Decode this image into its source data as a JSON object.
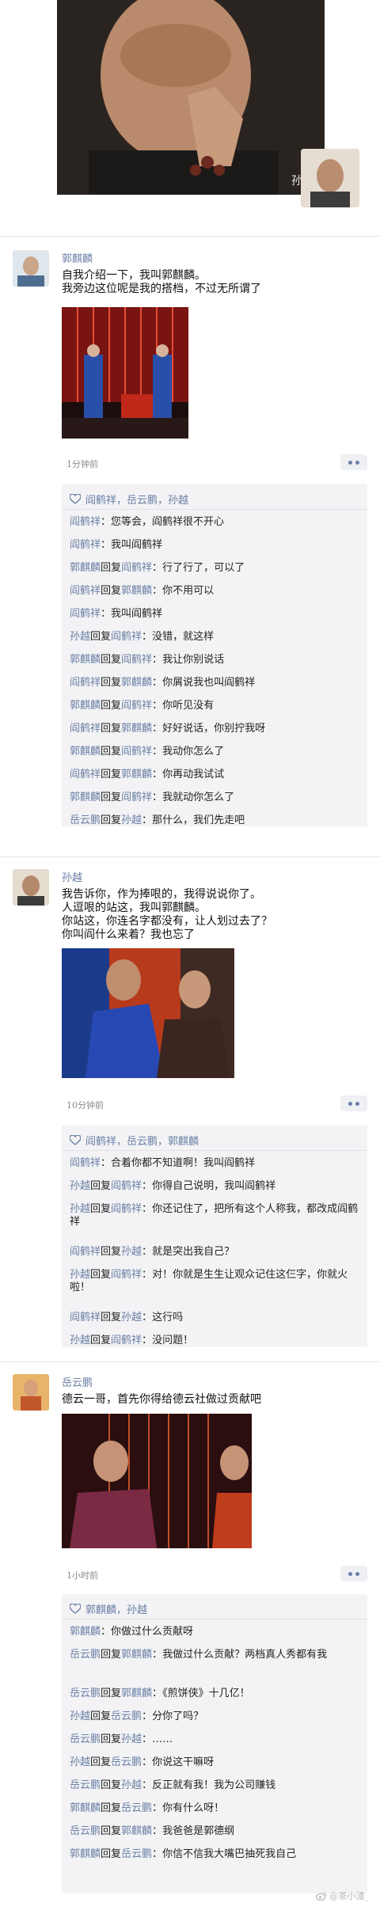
{
  "top": {
    "photo_caption": "孙越"
  },
  "posts": [
    {
      "author": "郭麒麟",
      "lines": [
        "自我介绍一下，我叫郭麒麟。",
        "我旁边这位呢是我的搭档，不过无所谓了"
      ],
      "time": "1分钟前",
      "likes": "阎鹤祥，岳云鹏，孙越",
      "comments": [
        {
          "name": "阎鹤祥",
          "reply": "",
          "to": "",
          "text": "您等会，阎鹤祥很不开心"
        },
        {
          "name": "阎鹤祥",
          "reply": "",
          "to": "",
          "text": "我叫阎鹤祥"
        },
        {
          "name": "郭麒麟",
          "reply": "回复",
          "to": "阎鹤祥",
          "text": "行了行了，可以了"
        },
        {
          "name": "阎鹤祥",
          "reply": "回复",
          "to": "郭麒麟",
          "text": "你不用可以"
        },
        {
          "name": "阎鹤祥",
          "reply": "",
          "to": "",
          "text": "我叫阎鹤祥"
        },
        {
          "name": "孙越",
          "reply": "回复",
          "to": "阎鹤祥",
          "text": "没错，就这样"
        },
        {
          "name": "郭麒麟",
          "reply": "回复",
          "to": "阎鹤祥",
          "text": "我让你别说话"
        },
        {
          "name": "阎鹤祥",
          "reply": "回复",
          "to": "郭麒麟",
          "text": "你屑说我也叫阎鹤祥"
        },
        {
          "name": "郭麒麟",
          "reply": "回复",
          "to": "阎鹤祥",
          "text": "你听见没有"
        },
        {
          "name": "阎鹤祥",
          "reply": "回复",
          "to": "郭麒麟",
          "text": "好好说话，你别拧我呀"
        },
        {
          "name": "郭麒麟",
          "reply": "回复",
          "to": "阎鹤祥",
          "text": "我动你怎么了"
        },
        {
          "name": "阎鹤祥",
          "reply": "回复",
          "to": "郭麒麟",
          "text": "你再动我试试"
        },
        {
          "name": "郭麒麟",
          "reply": "回复",
          "to": "阎鹤祥",
          "text": "我就动你怎么了"
        },
        {
          "name": "岳云鹏",
          "reply": "回复",
          "to": "孙越",
          "text": "那什么，我们先走吧"
        }
      ]
    },
    {
      "author": "孙越",
      "lines": [
        "我告诉你，作为捧哏的，我得说说你了。",
        "人逗哏的站这，我叫郭麒麟。",
        "你站这，你连名字都没有，让人划过去了？",
        "你叫阎什么来着？我也忘了"
      ],
      "time": "10分钟前",
      "likes": "阎鹤祥，岳云鹏，郭麒麟",
      "comments": [
        {
          "name": "阎鹤祥",
          "reply": "",
          "to": "",
          "text": "合着你都不知道啊！我叫阎鹤祥"
        },
        {
          "name": "孙越",
          "reply": "回复",
          "to": "阎鹤祥",
          "text": "你得自己说明，我叫阎鹤祥"
        },
        {
          "name": "孙越",
          "reply": "回复",
          "to": "阎鹤祥",
          "text": "你还记住了，把所有这个人称我，都改成阎鹤祥"
        },
        {
          "name": "阎鹤祥",
          "reply": "回复",
          "to": "孙越",
          "text": "就是突出我自己？"
        },
        {
          "name": "孙越",
          "reply": "回复",
          "to": "阎鹤祥",
          "text": "对！你就是生生让观众记住这仨字，你就火啦！"
        },
        {
          "name": "阎鹤祥",
          "reply": "回复",
          "to": "孙越",
          "text": "这行吗"
        },
        {
          "name": "孙越",
          "reply": "回复",
          "to": "阎鹤祥",
          "text": "没问题！"
        }
      ]
    },
    {
      "author": "岳云鹏",
      "lines": [
        "德云一哥，首先你得给德云社做过贡献吧"
      ],
      "time": "1小时前",
      "likes": "郭麒麟，孙越",
      "comments": [
        {
          "name": "郭麒麟",
          "reply": "",
          "to": "",
          "text": "你做过什么贡献呀"
        },
        {
          "name": "岳云鹏",
          "reply": "回复",
          "to": "郭麒麟",
          "text": "我做过什么贡献？两档真人秀都有我"
        },
        {
          "name": "岳云鹏",
          "reply": "回复",
          "to": "郭麒麟",
          "text": "《煎饼侠》十几亿！"
        },
        {
          "name": "孙越",
          "reply": "回复",
          "to": "岳云鹏",
          "text": "分你了吗？"
        },
        {
          "name": "岳云鹏",
          "reply": "回复",
          "to": "孙越",
          "text": "……"
        },
        {
          "name": "孙越",
          "reply": "回复",
          "to": "岳云鹏",
          "text": "你说这干嘛呀"
        },
        {
          "name": "岳云鹏",
          "reply": "回复",
          "to": "孙越",
          "text": "反正就有我！我为公司赚钱"
        },
        {
          "name": "郭麒麟",
          "reply": "回复",
          "to": "岳云鹏",
          "text": "你有什么呀！"
        },
        {
          "name": "岳云鹏",
          "reply": "回复",
          "to": "郭麒麟",
          "text": "我爸爸是郭德纲"
        },
        {
          "name": "郭麒麟",
          "reply": "回复",
          "to": "岳云鹏",
          "text": "你信不信我大嘴巴抽死我自己"
        }
      ]
    }
  ],
  "watermark": "@茶小渣_"
}
